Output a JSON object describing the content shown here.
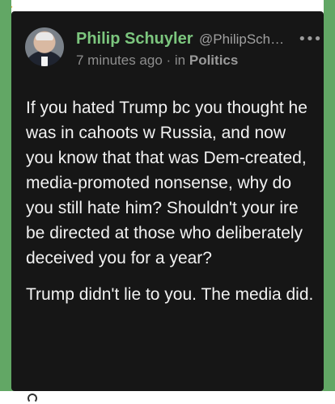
{
  "post": {
    "author_name": "Philip Schuyler",
    "handle": "@PhilipSchu...",
    "more_icon": "more-horizontal-icon",
    "timestamp": "7 minutes ago",
    "separator": " · in ",
    "category": "Politics",
    "paragraphs": [
      "If you hated Trump bc you thought he was in cahoots w Russia, and now you know that that was Dem-created, media-promoted nonsense, why do you still hate him? Shouldn't your ire be directed at those who deliberately deceived you for a year?",
      "Trump didn't lie to you. The media did."
    ]
  },
  "colors": {
    "accent_green": "#7cc67e",
    "card_background": "#161616",
    "border_green": "#62a765"
  }
}
